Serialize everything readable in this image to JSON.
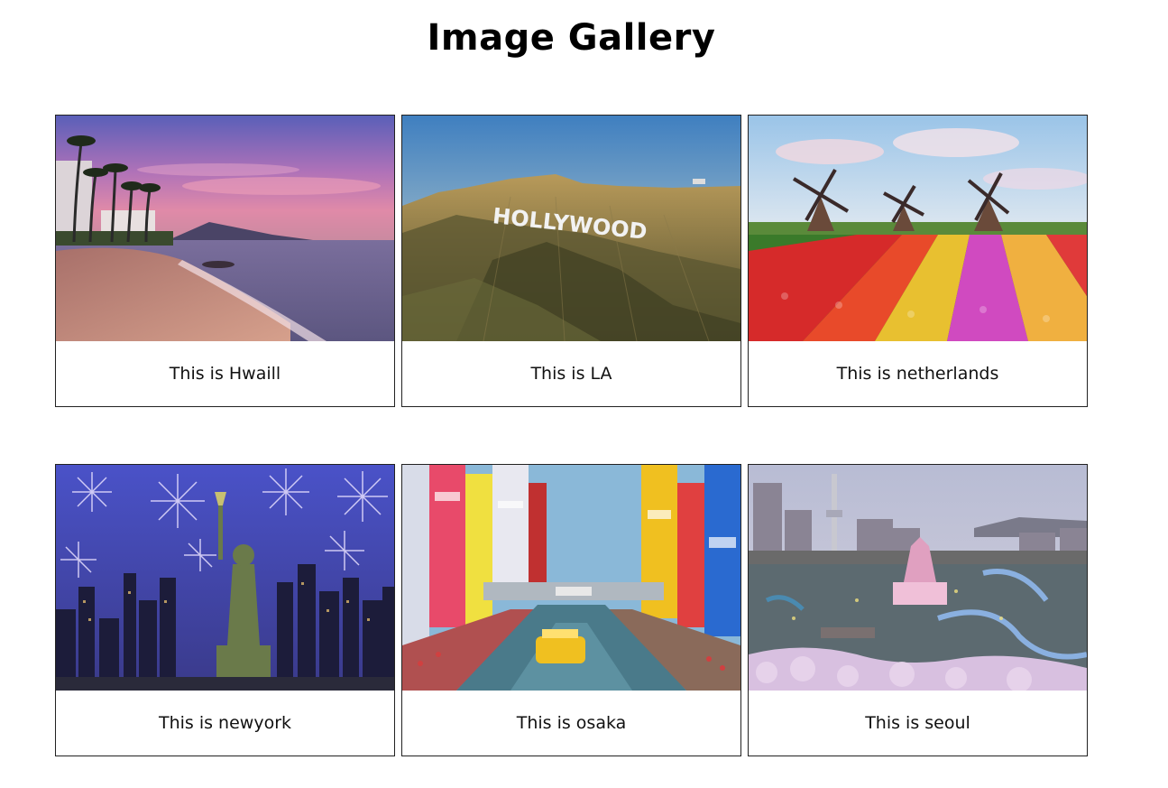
{
  "page": {
    "title": "Image Gallery"
  },
  "gallery": [
    {
      "id": "hwaiil",
      "caption": "This is Hwaill",
      "scene": "beach-sunset"
    },
    {
      "id": "la",
      "caption": "This is LA",
      "scene": "hollywood-hills",
      "sign_text": "HOLLYWOOD"
    },
    {
      "id": "netherlands",
      "caption": "This is netherlands",
      "scene": "tulip-windmills"
    },
    {
      "id": "newyork",
      "caption": "This is newyork",
      "scene": "statue-fireworks"
    },
    {
      "id": "osaka",
      "caption": "This is osaka",
      "scene": "canal-city"
    },
    {
      "id": "seoul",
      "caption": "This is seoul",
      "scene": "theme-park"
    }
  ]
}
